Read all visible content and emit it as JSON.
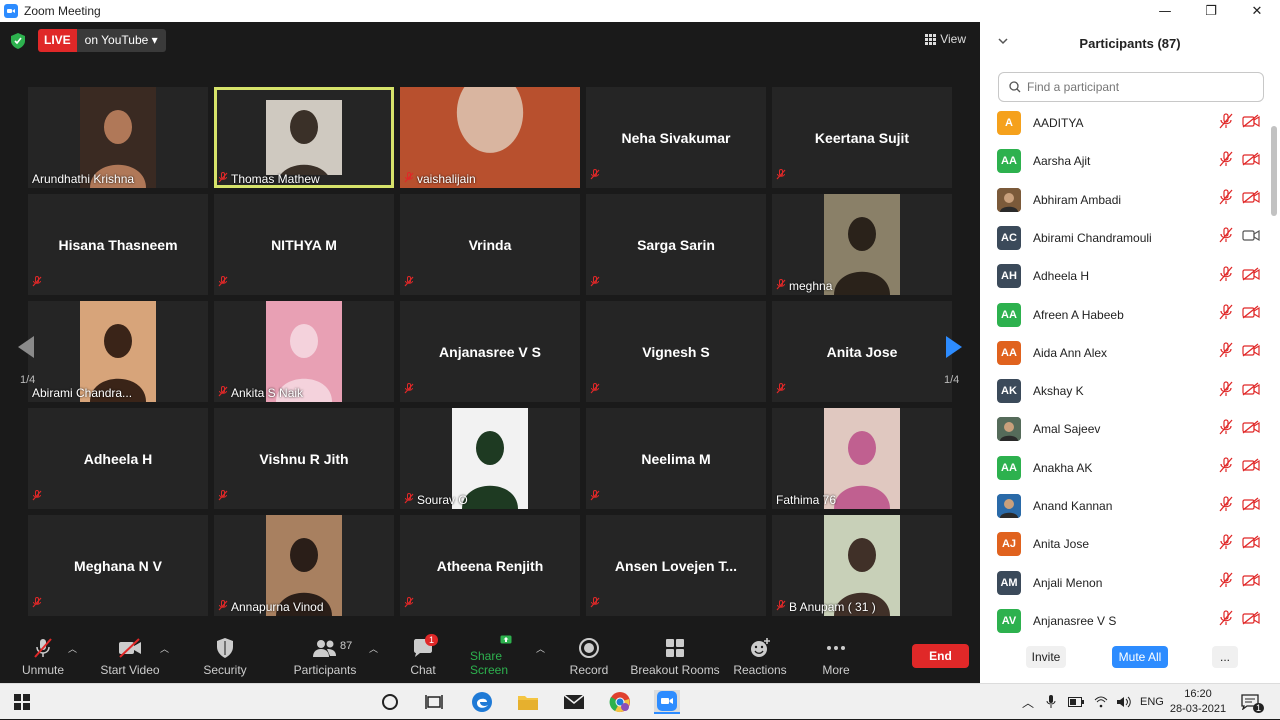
{
  "window": {
    "title": "Zoom Meeting",
    "min": "—",
    "max": "❐",
    "close": "✕"
  },
  "top": {
    "live": "LIVE",
    "youtube": "on YouTube ▾",
    "view": "View"
  },
  "pager": {
    "left": "1/4",
    "right": "1/4"
  },
  "tiles": [
    {
      "name": "Arundhathi Krishna",
      "kind": "video",
      "muted": false
    },
    {
      "name": "Thomas Mathew",
      "kind": "video",
      "muted": true,
      "active": true
    },
    {
      "name": "vaishalijain",
      "kind": "video",
      "muted": true
    },
    {
      "name": "Neha Sivakumar",
      "kind": "name",
      "muted": true
    },
    {
      "name": "Keertana Sujit",
      "kind": "name",
      "muted": true
    },
    {
      "name": "Hisana Thasneem",
      "kind": "name",
      "muted": true
    },
    {
      "name": "NITHYA M",
      "kind": "name",
      "muted": true
    },
    {
      "name": "Vrinda",
      "kind": "name",
      "muted": true
    },
    {
      "name": "Sarga Sarin",
      "kind": "name",
      "muted": true
    },
    {
      "name": "meghna",
      "kind": "video",
      "muted": true
    },
    {
      "name": "Abirami Chandra...",
      "kind": "video",
      "muted": false
    },
    {
      "name": "Ankita S Naik",
      "kind": "video",
      "muted": true
    },
    {
      "name": "Anjanasree V S",
      "kind": "name",
      "muted": true
    },
    {
      "name": "Vignesh S",
      "kind": "name",
      "muted": true
    },
    {
      "name": "Anita Jose",
      "kind": "name",
      "muted": true
    },
    {
      "name": "Adheela H",
      "kind": "name",
      "muted": true
    },
    {
      "name": "Vishnu R Jith",
      "kind": "name",
      "muted": true
    },
    {
      "name": "Sourav O",
      "kind": "video",
      "muted": true
    },
    {
      "name": "Neelima M",
      "kind": "name",
      "muted": true
    },
    {
      "name": "Fathima 76",
      "kind": "video",
      "muted": false
    },
    {
      "name": "Meghana N V",
      "kind": "name",
      "muted": true
    },
    {
      "name": "Annapurna Vinod",
      "kind": "video",
      "muted": true
    },
    {
      "name": "Atheena Renjith",
      "kind": "name",
      "muted": true
    },
    {
      "name": "Ansen Lovejen T...",
      "kind": "name",
      "muted": true
    },
    {
      "name": "B Anupam ( 31 )",
      "kind": "video",
      "muted": true
    }
  ],
  "toolbar": {
    "unmute": "Unmute",
    "start_video": "Start Video",
    "security": "Security",
    "participants": "Participants",
    "participants_count": "87",
    "chat": "Chat",
    "chat_badge": "1",
    "share": "Share Screen",
    "record": "Record",
    "breakout": "Breakout Rooms",
    "reactions": "Reactions",
    "more": "More",
    "end": "End"
  },
  "panel": {
    "title": "Participants (87)",
    "search_placeholder": "Find a participant",
    "invite": "Invite",
    "mute_all": "Mute All",
    "more": "...",
    "participants": [
      {
        "initials": "A",
        "name": "AADITYA",
        "color": "#f5a11c",
        "cam": "off"
      },
      {
        "initials": "AA",
        "name": "Aarsha Ajit",
        "color": "#2db14e",
        "cam": "off"
      },
      {
        "initials": "",
        "name": "Abhiram Ambadi",
        "color": "#7b5a3a",
        "cam": "off"
      },
      {
        "initials": "AC",
        "name": "Abirami Chandramouli",
        "color": "#3b4a5a",
        "cam": "on"
      },
      {
        "initials": "AH",
        "name": "Adheela H",
        "color": "#3b4a5a",
        "cam": "off"
      },
      {
        "initials": "AA",
        "name": "Afreen A Habeeb",
        "color": "#2db14e",
        "cam": "off"
      },
      {
        "initials": "AA",
        "name": "Aida Ann Alex",
        "color": "#e0621e",
        "cam": "off"
      },
      {
        "initials": "AK",
        "name": "Akshay K",
        "color": "#3b4a5a",
        "cam": "off"
      },
      {
        "initials": "",
        "name": "Amal Sajeev",
        "color": "#556b5a",
        "cam": "off"
      },
      {
        "initials": "AA",
        "name": "Anakha AK",
        "color": "#2db14e",
        "cam": "off"
      },
      {
        "initials": "",
        "name": "Anand Kannan",
        "color": "#2a6aa8",
        "cam": "off"
      },
      {
        "initials": "AJ",
        "name": "Anita Jose",
        "color": "#e0621e",
        "cam": "off"
      },
      {
        "initials": "AM",
        "name": "Anjali Menon",
        "color": "#3b4a5a",
        "cam": "off"
      },
      {
        "initials": "AV",
        "name": "Anjanasree V S",
        "color": "#2db14e",
        "cam": "off"
      }
    ]
  },
  "taskbar": {
    "lang": "ENG",
    "time": "16:20",
    "date": "28-03-2021",
    "notif": "1"
  }
}
